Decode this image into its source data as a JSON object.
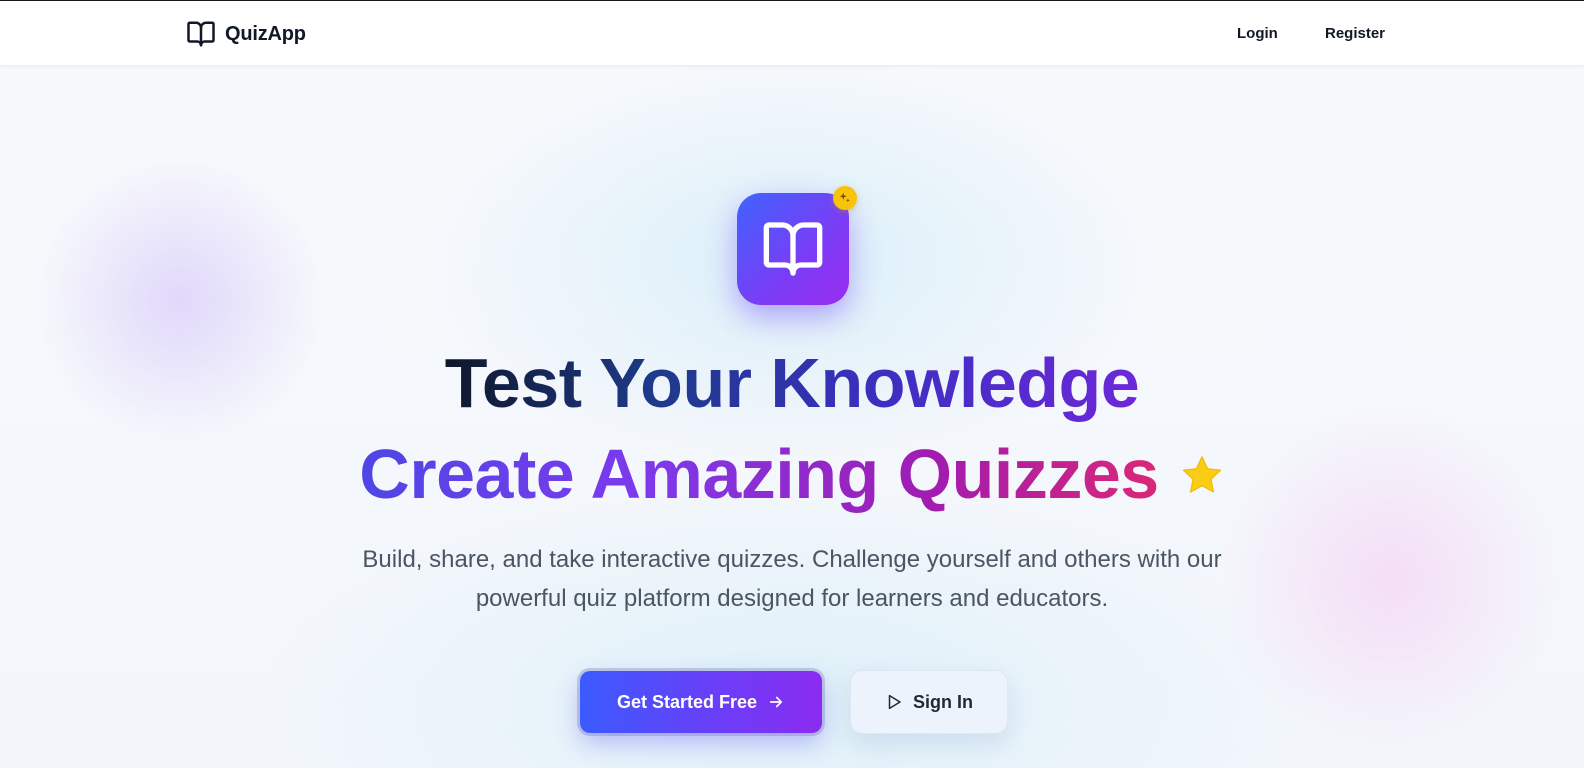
{
  "nav": {
    "brand": "QuizApp",
    "brand_icon": "book-open-icon",
    "links": [
      "Login",
      "Register"
    ]
  },
  "hero": {
    "logo_icon": "book-open-icon",
    "badge_icon": "sparkle-icon",
    "title_line1": "Test Your Knowledge",
    "title_line2": "Create Amazing Quizzes",
    "title_icon": "star-icon",
    "subtitle": "Build, share, and take interactive quizzes. Challenge yourself and others with our powerful quiz platform designed for learners and educators.",
    "primary_button": "Get Started Free",
    "primary_button_icon": "arrow-right-icon",
    "secondary_button": "Sign In",
    "secondary_button_icon": "play-icon"
  },
  "colors": {
    "accent_blue": "#3b5bff",
    "accent_purple": "#8b2cf0",
    "badge_yellow": "#f7c30c",
    "text_dark": "#111827",
    "text_muted": "#4b5563"
  }
}
